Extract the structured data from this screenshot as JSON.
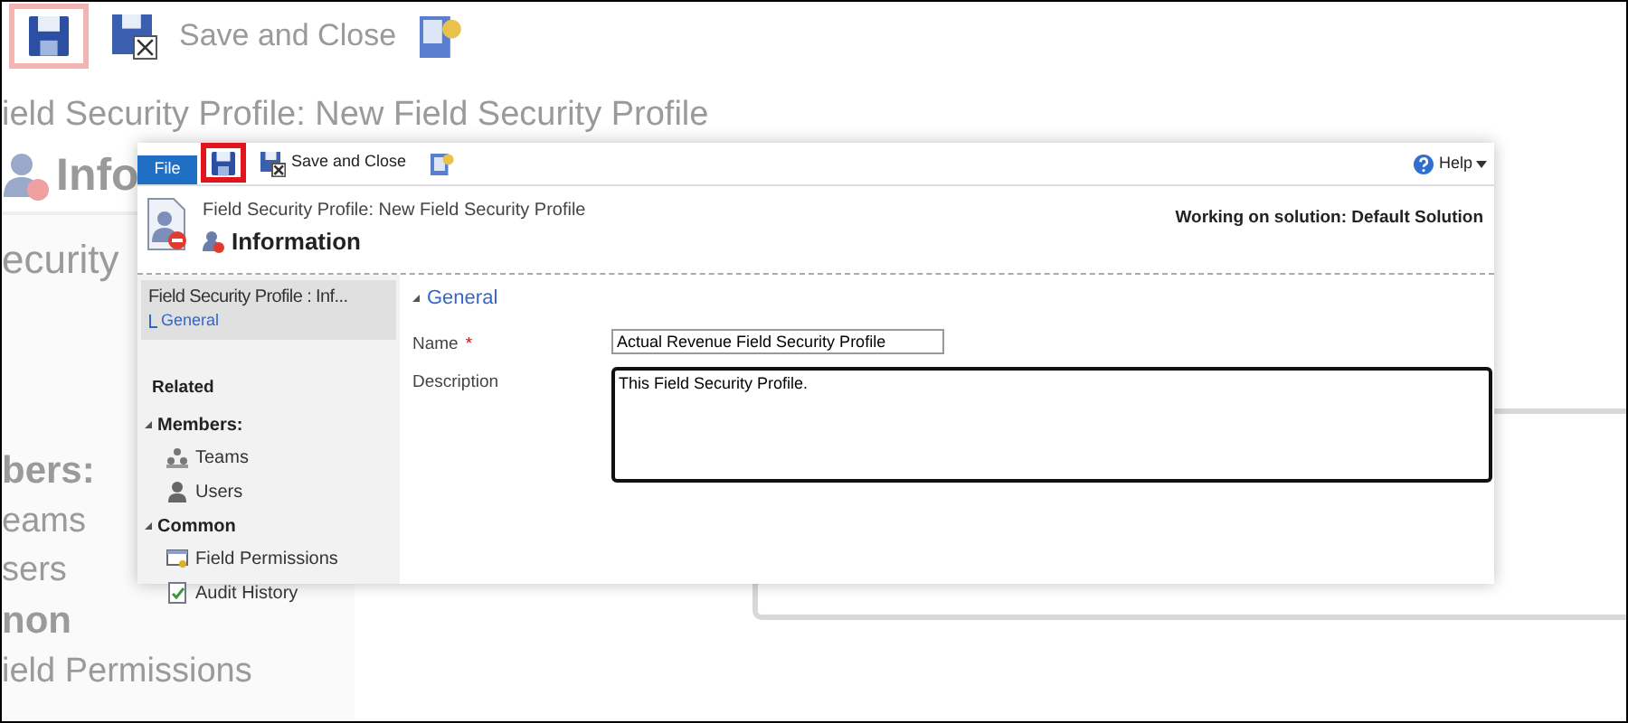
{
  "background": {
    "save_highlighted": true,
    "toolbar_label": "Save and Close",
    "subtitle": "ield Security Profile: New Field Security Profile",
    "title": "Info",
    "section": "ecurity",
    "nav_items": [
      {
        "label": "bers:",
        "kind": "heading"
      },
      {
        "label": "eams",
        "kind": "item"
      },
      {
        "label": "sers",
        "kind": "item"
      },
      {
        "label": "non",
        "kind": "heading"
      },
      {
        "label": "ield Permissions",
        "kind": "item"
      }
    ]
  },
  "ribbon": {
    "tabs": [
      {
        "label": "File",
        "selected": true
      }
    ],
    "buttons": [
      {
        "kind": "save",
        "highlighted": true
      },
      {
        "kind": "save_close",
        "label": "Save and Close",
        "highlighted": false
      },
      {
        "kind": "assign",
        "highlighted": false
      }
    ],
    "help": "Help"
  },
  "header": {
    "entity": "Field Security Profile: New Field Security Profile",
    "form_name": "Information",
    "solution": "Working on solution: Default Solution"
  },
  "nav": {
    "record_title": "Field Security Profile : Inf...",
    "sections": [
      {
        "label": "General",
        "selected": true
      }
    ],
    "related_heading": "Related",
    "groups": [
      {
        "label": "Members:",
        "expanded": true,
        "items": [
          {
            "label": "Teams",
            "kind": "teams"
          },
          {
            "label": "Users",
            "kind": "users"
          }
        ]
      },
      {
        "label": "Common",
        "expanded": true,
        "items": [
          {
            "label": "Field Permissions",
            "kind": "permissions"
          },
          {
            "label": "Audit History",
            "kind": "audit"
          }
        ]
      }
    ]
  },
  "form": {
    "section": {
      "label": "General",
      "expanded": true
    },
    "fields": [
      {
        "label": "Name",
        "required_mark": "*",
        "kind": "text",
        "value": "Actual Revenue Field Security Profile",
        "focused": false
      },
      {
        "label": "Description",
        "kind": "textarea",
        "value": "This Field Security Profile.",
        "focused": true
      }
    ]
  }
}
